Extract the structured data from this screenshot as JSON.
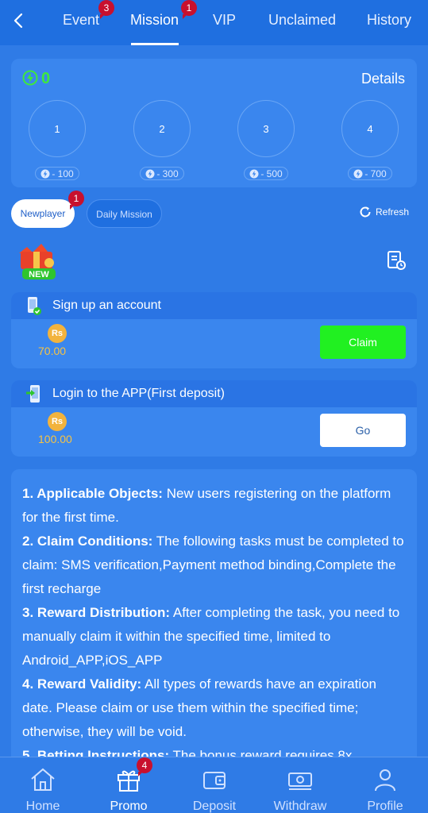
{
  "tabs": [
    {
      "label": "Event",
      "badge": "3"
    },
    {
      "label": "Mission",
      "badge": "1",
      "active": true
    },
    {
      "label": "VIP"
    },
    {
      "label": "Unclaimed"
    },
    {
      "label": "History"
    }
  ],
  "points": {
    "value": "0",
    "details_label": "Details"
  },
  "steps": [
    {
      "number": "1",
      "cost": "- 100"
    },
    {
      "number": "2",
      "cost": "- 300"
    },
    {
      "number": "3",
      "cost": "- 500"
    },
    {
      "number": "4",
      "cost": "- 700"
    }
  ],
  "filters": {
    "newplayer": {
      "label": "Newplayer",
      "badge": "1"
    },
    "daily": {
      "label": "Daily Mission"
    },
    "refresh": "Refresh"
  },
  "new_tag": "NEW",
  "tasks": [
    {
      "title": "Sign up an account",
      "currency": "Rs",
      "amount": "70.00",
      "button": "Claim"
    },
    {
      "title": "Login to the APP(First deposit)",
      "currency": "Rs",
      "amount": "100.00",
      "button": "Go"
    }
  ],
  "rules": [
    {
      "head": "1. Applicable Objects:",
      "text": " New users registering on the platform for the first time."
    },
    {
      "head": "2. Claim Conditions:",
      "text": " The following tasks must be completed to claim: SMS verification,Payment method binding,Complete the first recharge"
    },
    {
      "head": "3. Reward Distribution:",
      "text": " After completing the task, you need to manually claim it within the specified time, limited to Android_APP,iOS_APP"
    },
    {
      "head": "4. Reward Validity:",
      "text": " All types of rewards have an expiration date. Please claim or use them within the specified time; otherwise, they will be void."
    },
    {
      "head": "5. Betting Instructions:",
      "text": " The bonus reward requires 8x"
    }
  ],
  "nav": [
    {
      "label": "Home",
      "icon": "home-icon"
    },
    {
      "label": "Promo",
      "icon": "gift-icon",
      "badge": "4",
      "active": true
    },
    {
      "label": "Deposit",
      "icon": "wallet-icon"
    },
    {
      "label": "Withdraw",
      "icon": "cash-icon"
    },
    {
      "label": "Profile",
      "icon": "person-icon"
    }
  ],
  "colors": {
    "accent": "#2f7be6",
    "claim": "#21f021",
    "badge": "#c8102e",
    "points": "#3ee83e",
    "reward": "#f5c344"
  }
}
